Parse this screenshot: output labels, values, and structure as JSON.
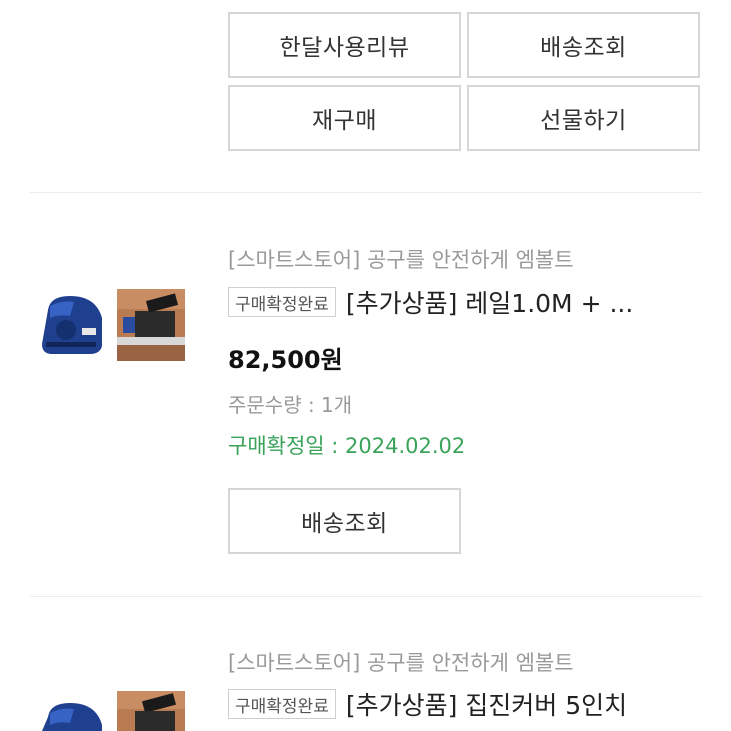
{
  "top_actions": {
    "review_button": "한달사용리뷰",
    "shipping_button": "배송조회",
    "rebuy_button": "재구매",
    "gift_button": "선물하기"
  },
  "orders": [
    {
      "store": "[스마트스토어] 공구를 안전하게 엠볼트",
      "status_badge": "구매확정완료",
      "product_name": "[추가상품] 레일1.0M + ...",
      "price": "82,500원",
      "quantity": "주문수량 : 1개",
      "confirm_date": "구매확정일 : 2024.02.02",
      "shipping_button": "배송조회"
    },
    {
      "store": "[스마트스토어] 공구를 안전하게 엠볼트",
      "status_badge": "구매확정완료",
      "product_name": "[추가상품] 집진커버 5인치"
    }
  ],
  "colors": {
    "confirm_green": "#3aa35a",
    "border_gray": "#d6d6d6",
    "muted_text": "#9a9a9a"
  }
}
